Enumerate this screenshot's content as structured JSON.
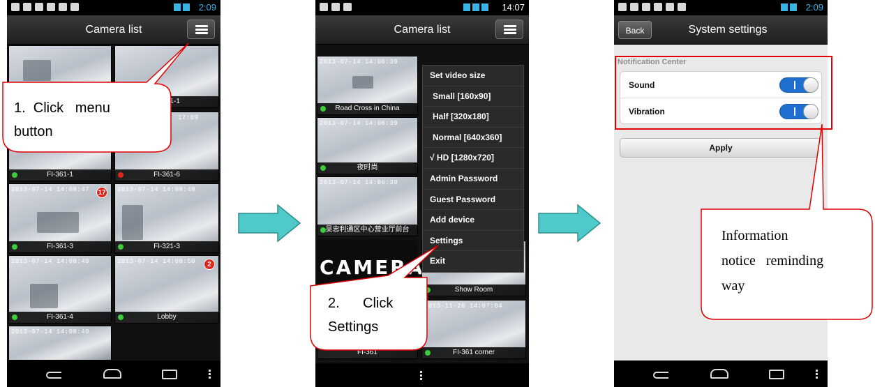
{
  "phone1": {
    "time": "2:09",
    "title": "Camera list",
    "cameras": [
      {
        "stamp": "",
        "label": "",
        "status": "online"
      },
      {
        "stamp": "",
        "label": "FI-321-1",
        "status": "online"
      },
      {
        "stamp": "",
        "label": "FI-361-1",
        "status": "online"
      },
      {
        "stamp": "",
        "label": "FI-361-6",
        "status": "offline"
      },
      {
        "stamp": "2013-07-14 14:08:47",
        "label": "FI-361-3",
        "status": "online",
        "badge": "17"
      },
      {
        "stamp": "2013-07-14 14:08:48",
        "label": "FI-321-3",
        "status": "online"
      },
      {
        "stamp": "2013-07-14 14:08:49",
        "label": "FI-361-4",
        "status": "online"
      },
      {
        "stamp": "2013-07-14 14:08:50",
        "label": "Lobby",
        "status": "online",
        "badge": "2"
      },
      {
        "stamp": "2013-07-14 14:08:49",
        "label": "",
        "status": "online"
      }
    ],
    "callout": {
      "line1": "1.  Click   menu",
      "line2": "button"
    }
  },
  "phone2": {
    "time": "14:07",
    "title": "Camera list",
    "cameras": [
      {
        "stamp": "2013-07-14 14:06:39",
        "label": "Road Cross in China",
        "status": "online"
      },
      {
        "stamp": "2013-07-14 14:06:39",
        "label": "夜时尚",
        "status": "online"
      },
      {
        "stamp": "2013-07-14 14:06:39",
        "label": "吴忠利通区中心营业厅前台",
        "status": "online"
      },
      {
        "stamp": "",
        "label": "Show Room",
        "status": "online"
      },
      {
        "stamp": "2013-11-20 14:07:04",
        "label": "FI-361 corner",
        "status": "online"
      },
      {
        "stamp": "",
        "label": "FI-361",
        "status": "online"
      }
    ],
    "brand_text": "CAMERA",
    "menu": [
      {
        "label": "Set video size",
        "sub": false
      },
      {
        "label": "Small [160x90]",
        "sub": true
      },
      {
        "label": "Half [320x180]",
        "sub": true
      },
      {
        "label": "Normal [640x360]",
        "sub": true
      },
      {
        "label": "√ HD [1280x720]",
        "sub": false
      },
      {
        "label": "Admin Password",
        "sub": false
      },
      {
        "label": "Guest Password",
        "sub": false
      },
      {
        "label": "Add device",
        "sub": false
      },
      {
        "label": "Settings",
        "sub": false
      },
      {
        "label": "Exit",
        "sub": false
      }
    ],
    "callout": {
      "line1": "2.      Click",
      "line2": "Settings"
    }
  },
  "phone3": {
    "time": "2:09",
    "back_label": "Back",
    "title": "System settings",
    "section": "Notification Center",
    "rows": [
      {
        "label": "Sound",
        "on": true,
        "toggle_text": "I"
      },
      {
        "label": "Vibration",
        "on": true,
        "toggle_text": "I"
      }
    ],
    "apply_label": "Apply",
    "callout": {
      "line1": "Information",
      "line2": "notice   reminding",
      "line3": "way"
    }
  },
  "colors": {
    "accent_red": "#e00000",
    "arrow_teal": "#4fc9c9",
    "toggle_blue": "#1e6fd0",
    "status_blue": "#39b3e6"
  }
}
